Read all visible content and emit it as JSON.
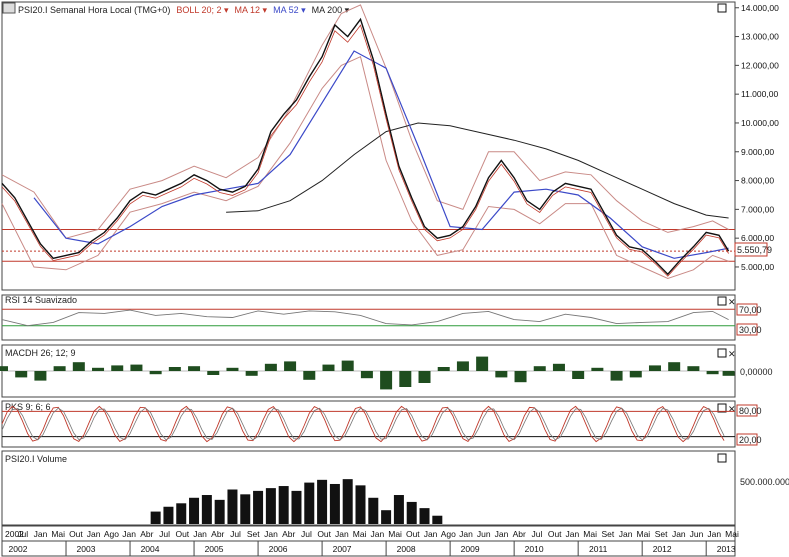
{
  "chart_data": {
    "type": "line",
    "symbol": "PSI20.I",
    "main_panel": {
      "legend": [
        {
          "text": "PSI20.I Semanal Hora Local (TMG+0)",
          "color": "#222222"
        },
        {
          "text": "BOLL 20; 2",
          "color": "#c0392b"
        },
        {
          "text": "MA 12",
          "color": "#c0392b"
        },
        {
          "text": "MA 52",
          "color": "#3b49c8"
        },
        {
          "text": "MA 200",
          "color": "#222222"
        }
      ],
      "yaxis_ticks": [
        "5.000,00",
        "6.000,00",
        "7.000,00",
        "8.000,00",
        "9.000,00",
        "10.000,00",
        "11.000,00",
        "12.000,00",
        "13.000,00",
        "14.000,00"
      ],
      "ylim": [
        4200,
        14200
      ],
      "last_value_label": "5.550,79",
      "price_series": {
        "x": [
          2002.0,
          2002.2,
          2002.4,
          2002.6,
          2002.8,
          2003.0,
          2003.2,
          2003.4,
          2003.6,
          2003.8,
          2004.0,
          2004.2,
          2004.4,
          2004.6,
          2004.8,
          2005.0,
          2005.2,
          2005.4,
          2005.6,
          2005.8,
          2006.0,
          2006.2,
          2006.4,
          2006.6,
          2006.8,
          2007.0,
          2007.2,
          2007.4,
          2007.6,
          2007.8,
          2008.0,
          2008.2,
          2008.4,
          2008.6,
          2008.8,
          2009.0,
          2009.2,
          2009.4,
          2009.6,
          2009.8,
          2010.0,
          2010.2,
          2010.4,
          2010.6,
          2010.8,
          2011.0,
          2011.2,
          2011.4,
          2011.6,
          2011.8,
          2012.0,
          2012.2,
          2012.4,
          2012.6,
          2012.8,
          2013.0,
          2013.2,
          2013.35
        ],
        "y": [
          7900,
          7400,
          6600,
          5800,
          5300,
          5400,
          5500,
          5900,
          6200,
          6700,
          7300,
          7600,
          7500,
          7700,
          7900,
          8200,
          8000,
          7700,
          7600,
          7800,
          8400,
          9700,
          10300,
          10800,
          11600,
          12300,
          13400,
          13000,
          13600,
          12200,
          10300,
          8500,
          7400,
          6400,
          6000,
          6100,
          6400,
          7100,
          8100,
          8700,
          8100,
          7300,
          7000,
          7600,
          7900,
          7800,
          7700,
          6900,
          6100,
          5700,
          5600,
          5200,
          4750,
          5250,
          5700,
          6200,
          6100,
          5550
        ]
      },
      "ma52": {
        "x": [
          2002.5,
          2003.0,
          2003.5,
          2004.0,
          2004.5,
          2005.0,
          2005.5,
          2006.0,
          2006.5,
          2007.0,
          2007.5,
          2008.0,
          2008.5,
          2009.0,
          2009.5,
          2010.0,
          2010.5,
          2011.0,
          2011.5,
          2012.0,
          2012.5,
          2013.0,
          2013.35
        ],
        "y": [
          7400,
          6000,
          5800,
          6400,
          7100,
          7500,
          7700,
          7900,
          8900,
          10700,
          12500,
          11900,
          9200,
          6400,
          6300,
          7600,
          7700,
          7500,
          6700,
          5700,
          5300,
          5500,
          5650
        ]
      },
      "ma200": {
        "x": [
          2005.5,
          2006.0,
          2006.5,
          2007.0,
          2007.5,
          2008.0,
          2008.5,
          2009.0,
          2009.5,
          2010.0,
          2010.5,
          2011.0,
          2011.5,
          2012.0,
          2012.5,
          2013.0,
          2013.35
        ],
        "y": [
          6900,
          6950,
          7300,
          8000,
          8900,
          9700,
          10000,
          9900,
          9650,
          9400,
          9100,
          8700,
          8200,
          7700,
          7200,
          6800,
          6700
        ]
      },
      "bollinger_upper": {
        "x": [
          2002.0,
          2002.5,
          2003.0,
          2003.5,
          2004.0,
          2004.5,
          2005.0,
          2005.5,
          2006.0,
          2006.5,
          2007.0,
          2007.3,
          2007.6,
          2008.0,
          2008.4,
          2008.8,
          2009.2,
          2009.6,
          2010.0,
          2010.4,
          2010.8,
          2011.2,
          2011.6,
          2012.0,
          2012.4,
          2012.8,
          2013.1,
          2013.35
        ],
        "y": [
          8200,
          7600,
          6000,
          6300,
          7700,
          8000,
          8500,
          8100,
          8800,
          10500,
          12700,
          13800,
          14100,
          11900,
          9400,
          7300,
          7000,
          9000,
          9000,
          8000,
          8300,
          8200,
          7300,
          6600,
          6200,
          6400,
          6600,
          6300
        ]
      },
      "bollinger_lower": {
        "x": [
          2002.0,
          2002.5,
          2003.0,
          2003.5,
          2004.0,
          2004.5,
          2005.0,
          2005.5,
          2006.0,
          2006.5,
          2007.0,
          2007.3,
          2007.6,
          2008.0,
          2008.4,
          2008.8,
          2009.2,
          2009.6,
          2010.0,
          2010.4,
          2010.8,
          2011.2,
          2011.6,
          2012.0,
          2012.4,
          2012.8,
          2013.1,
          2013.35
        ],
        "y": [
          7200,
          5000,
          4900,
          5400,
          6900,
          7200,
          7600,
          7300,
          7800,
          9300,
          11200,
          12000,
          12300,
          8700,
          6600,
          5400,
          5600,
          7100,
          7000,
          6500,
          7200,
          7200,
          5400,
          5000,
          4600,
          4900,
          5400,
          5200
        ]
      },
      "horizontal_lines": [
        6300,
        5550,
        5200
      ]
    },
    "rsi_panel": {
      "label": "RSI 14 Suavizado",
      "levels": [
        "70,00",
        "30,00"
      ],
      "ylim": [
        0,
        100
      ],
      "x": [
        2002.0,
        2002.4,
        2002.8,
        2003.2,
        2003.6,
        2004.0,
        2004.4,
        2004.8,
        2005.2,
        2005.6,
        2006.0,
        2006.4,
        2006.8,
        2007.2,
        2007.6,
        2008.0,
        2008.4,
        2008.8,
        2009.2,
        2009.6,
        2010.0,
        2010.4,
        2010.8,
        2011.2,
        2011.6,
        2012.0,
        2012.4,
        2012.8,
        2013.1,
        2013.35
      ],
      "y": [
        45,
        30,
        38,
        62,
        60,
        68,
        55,
        60,
        52,
        50,
        66,
        58,
        66,
        64,
        55,
        35,
        32,
        40,
        60,
        65,
        45,
        40,
        58,
        50,
        35,
        38,
        40,
        62,
        65,
        45
      ]
    },
    "macd_panel": {
      "label": "MACDH 26; 12; 9",
      "ytick": "0,00000",
      "ylim": [
        -300,
        300
      ],
      "x": [
        2002.0,
        2002.3,
        2002.6,
        2002.9,
        2003.2,
        2003.5,
        2003.8,
        2004.1,
        2004.4,
        2004.7,
        2005.0,
        2005.3,
        2005.6,
        2005.9,
        2006.2,
        2006.5,
        2006.8,
        2007.1,
        2007.4,
        2007.7,
        2008.0,
        2008.3,
        2008.6,
        2008.9,
        2009.2,
        2009.5,
        2009.8,
        2010.1,
        2010.4,
        2010.7,
        2011.0,
        2011.3,
        2011.6,
        2011.9,
        2012.2,
        2012.5,
        2012.8,
        2013.1,
        2013.35
      ],
      "y": [
        60,
        -80,
        -120,
        60,
        110,
        40,
        70,
        80,
        -40,
        50,
        60,
        -50,
        40,
        -60,
        90,
        120,
        -110,
        80,
        130,
        -90,
        -230,
        -200,
        -150,
        50,
        120,
        180,
        -80,
        -140,
        60,
        90,
        -100,
        40,
        -120,
        -80,
        70,
        110,
        60,
        -40,
        -60
      ]
    },
    "pks_panel": {
      "label": "PKS 9; 6; 6",
      "levels": [
        "80,00",
        "20,00"
      ],
      "ylim": [
        0,
        100
      ]
    },
    "volume_panel": {
      "label": "PSI20.I Volume",
      "ytick": "500.000.000",
      "ylim": [
        0,
        1000000000
      ],
      "x": [
        2004.4,
        2004.6,
        2004.8,
        2005.0,
        2005.2,
        2005.4,
        2005.6,
        2005.8,
        2006.0,
        2006.2,
        2006.4,
        2006.6,
        2006.8,
        2007.0,
        2007.2,
        2007.4,
        2007.6,
        2007.8,
        2008.0,
        2008.2,
        2008.4,
        2008.6,
        2008.8
      ],
      "y": [
        180000000,
        250000000,
        300000000,
        380000000,
        420000000,
        350000000,
        500000000,
        430000000,
        480000000,
        520000000,
        550000000,
        480000000,
        600000000,
        640000000,
        580000000,
        650000000,
        560000000,
        380000000,
        200000000,
        420000000,
        320000000,
        230000000,
        120000000
      ]
    },
    "x_months": [
      "2002",
      "Jul",
      "Jan",
      "Mai",
      "Out",
      "Jan",
      "Ago",
      "Jan",
      "Abr",
      "Jul",
      "Out",
      "Jan",
      "Abr",
      "Jul",
      "Set",
      "Jan",
      "Abr",
      "Jul",
      "Out",
      "Jan",
      "Mai",
      "Jan",
      "Mai",
      "Out",
      "Jan",
      "Ago",
      "Jan",
      "Jun",
      "Jan",
      "Abr",
      "Jul",
      "Out",
      "Jan",
      "Mai",
      "Set",
      "Jan",
      "Mai",
      "Set",
      "Jan",
      "Jun",
      "Jan",
      "Mai"
    ],
    "x_years": [
      "2002",
      "2003",
      "2004",
      "2005",
      "2006",
      "2007",
      "2008",
      "2009",
      "2010",
      "2011",
      "2012",
      "2013"
    ]
  }
}
